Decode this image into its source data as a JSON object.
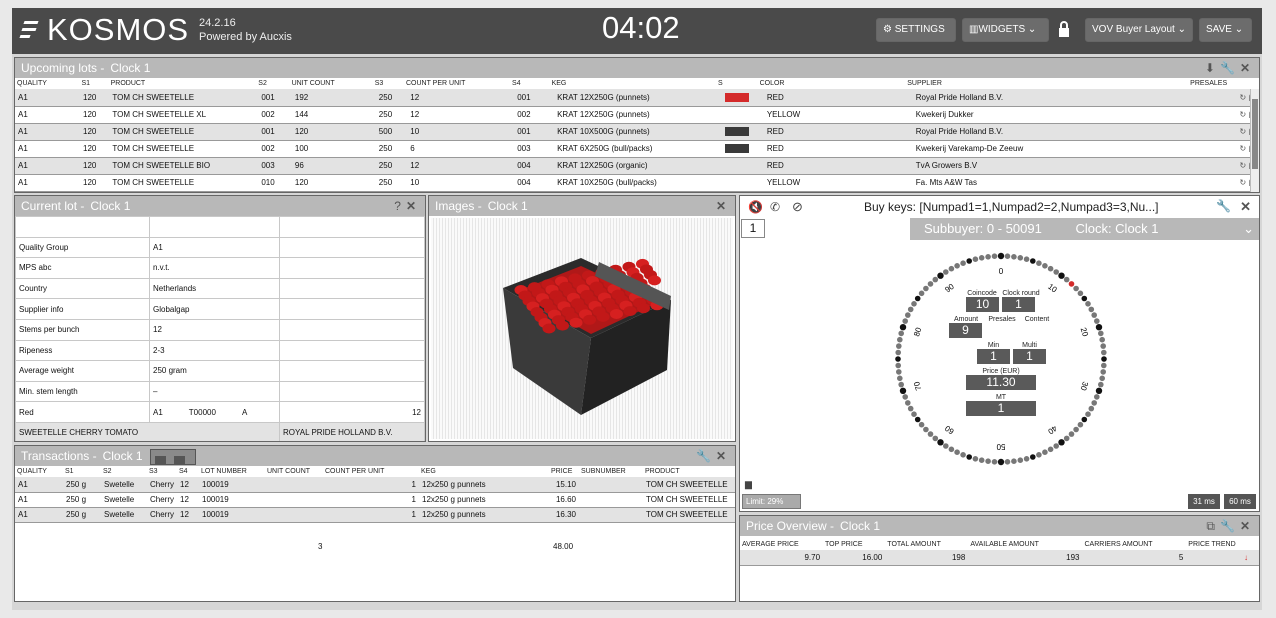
{
  "app": {
    "brand": "KOSMOS",
    "version": "24.2.16",
    "powered": "Powered by Aucxis",
    "clock": "04:02",
    "settings_label": "SETTINGS",
    "widgets_label": "WIDGETS",
    "layout_label": "VOV Buyer Layout",
    "save_label": "SAVE"
  },
  "upcoming": {
    "title": "Upcoming lots",
    "clock": "Clock 1",
    "headers": [
      "QUALITY",
      "S1",
      "PRODUCT",
      "S2",
      "UNIT COUNT",
      "S3",
      "COUNT PER UNIT",
      "S4",
      "KEG",
      "S",
      "COLOR",
      "SUPPLIER",
      "PRESALES"
    ],
    "rows": [
      [
        "A1",
        "120",
        "TOM CH SWEETELLE",
        "001",
        "192",
        "250",
        "12",
        "001",
        "KRAT 12X250G (punnets)",
        "#d42a2a",
        "RED",
        "Royal Pride Holland B.V."
      ],
      [
        "A1",
        "120",
        "TOM CH SWEETELLE  XL",
        "002",
        "144",
        "250",
        "12",
        "002",
        "KRAT 12X250G (punnets)",
        "",
        "YELLOW",
        "Kwekerij Dukker"
      ],
      [
        "A1",
        "120",
        "TOM CH SWEETELLE",
        "001",
        "120",
        "500",
        "10",
        "001",
        "KRAT 10X500G (punnets)",
        "#3a3a3a",
        "RED",
        "Royal Pride Holland B.V."
      ],
      [
        "A1",
        "120",
        "TOM CH SWEETELLE",
        "002",
        "100",
        "250",
        "6",
        "003",
        "KRAT 6X250G (bull/packs)",
        "#3a3a3a",
        "RED",
        "Kwekerij Varekamp-De Zeeuw"
      ],
      [
        "A1",
        "120",
        "TOM CH SWEETELLE  BIO",
        "003",
        "96",
        "250",
        "12",
        "004",
        "KRAT 12X250G (organic)",
        "",
        "RED",
        "TvA Growers B.V"
      ],
      [
        "A1",
        "120",
        "TOM CH SWEETELLE",
        "010",
        "120",
        "250",
        "10",
        "004",
        "KRAT 10X250G (bull/packs)",
        "",
        "YELLOW",
        "Fa. Mts A&W Tas"
      ]
    ]
  },
  "current": {
    "title": "Current lot",
    "clock": "Clock 1",
    "rows": [
      [
        "Quality Group",
        "A1"
      ],
      [
        "MPS abc",
        "n.v.t."
      ],
      [
        "Country",
        "Netherlands"
      ],
      [
        "Supplier info",
        "Globalgap"
      ],
      [
        "Stems per bunch",
        "12"
      ],
      [
        "Ripeness",
        "2-3"
      ],
      [
        "Average weight",
        "250 gram"
      ],
      [
        "Min. stem length",
        "–"
      ]
    ],
    "red_label": "Red",
    "red_q": "A1",
    "red_code": "T00000",
    "red_cls": "A",
    "red_num": "12",
    "product_name": "SWEETELLE CHERRY TOMATO",
    "supplier_name": "ROYAL PRIDE HOLLAND B.V."
  },
  "images": {
    "title": "Images",
    "clock": "Clock 1"
  },
  "buykeys": {
    "text": "Buy keys: [Numpad1=1,Numpad2=2,Numpad3=3,Nu...]",
    "page": "1",
    "subbuyer": "Subbuyer:  0 - 50091",
    "clock": "Clock: Clock 1",
    "coincode_l": "Coincode",
    "coincode": "10",
    "round_l": "Clock round",
    "round": "1",
    "amount_l": "Amount",
    "amount": "9",
    "presales_l": "Presales",
    "content_l": "Content",
    "min_l": "Min",
    "min": "1",
    "multi_l": "Multi",
    "multi": "1",
    "price_l": "Price (EUR)",
    "price": "11.30",
    "mt_l": "MT",
    "mt": "1",
    "limit": "Limit: 29%",
    "ms1": "31 ms",
    "ms2": "60 ms",
    "dial_ticks": [
      "0",
      "10",
      "20",
      "30",
      "40",
      "50",
      "60",
      "70",
      "80",
      "90"
    ]
  },
  "transactions": {
    "title": "Transactions",
    "clock": "Clock 1",
    "headers": [
      "QUALITY",
      "S1",
      "S2",
      "S3",
      "S4",
      "LOT NUMBER",
      "UNIT COUNT",
      "COUNT PER UNIT",
      "KEG",
      "PRICE",
      "SUBNUMBER",
      "PRODUCT"
    ],
    "rows": [
      [
        "A1",
        "250 g",
        "Swetelle",
        "Cherry",
        "12",
        "100019",
        "1",
        "12x250 g punnets",
        "15.10",
        "TOM CH SWEETELLE"
      ],
      [
        "A1",
        "250 g",
        "Swetelle",
        "Cherry",
        "12",
        "100019",
        "1",
        "12x250 g punnets",
        "16.60",
        "TOM CH SWEETELLE"
      ],
      [
        "A1",
        "250 g",
        "Swetelle",
        "Cherry",
        "12",
        "100019",
        "1",
        "12x250 g punnets",
        "16.30",
        "TOM CH SWEETELLE"
      ]
    ],
    "total_count": "3",
    "total_price": "48.00"
  },
  "price": {
    "title": "Price Overview",
    "clock": "Clock 1",
    "headers": [
      "AVERAGE PRICE",
      "TOP PRICE",
      "TOTAL AMOUNT",
      "AVAILABLE AMOUNT",
      "CARRIERS AMOUNT",
      "PRICE TREND"
    ],
    "values": [
      "9.70",
      "16.00",
      "198",
      "193",
      "5"
    ],
    "trend": "down"
  },
  "colors": {
    "header": "#b8b8b8",
    "topbar": "#4a4a4a",
    "red": "#d42a2a"
  }
}
